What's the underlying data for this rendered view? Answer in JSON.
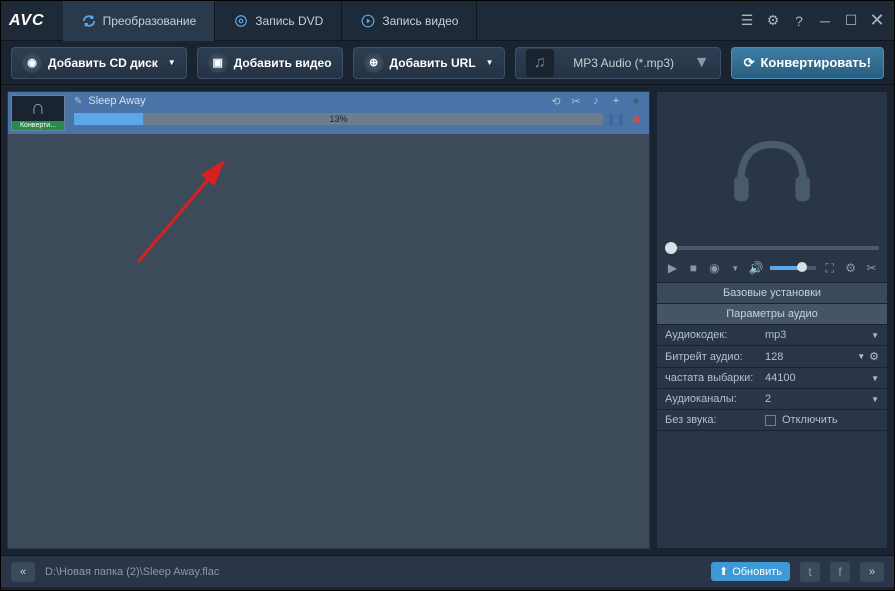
{
  "logo": "AVC",
  "tabs": [
    {
      "label": "Преобразование"
    },
    {
      "label": "Запись DVD"
    },
    {
      "label": "Запись видео"
    }
  ],
  "toolbar": {
    "addCd": "Добавить CD диск",
    "addVideo": "Добавить видео",
    "addUrl": "Добавить URL"
  },
  "format": {
    "label": "MP3 Audio (*.mp3)"
  },
  "convert": "Конвертировать!",
  "item": {
    "title": "Sleep Away",
    "status": "Конверти...",
    "progress": "13%"
  },
  "settings": {
    "header1": "Базовые установки",
    "header2": "Параметры аудио",
    "rows": [
      {
        "k": "Аудиокодек:",
        "v": "mp3"
      },
      {
        "k": "Битрейт аудио:",
        "v": "128"
      },
      {
        "k": "частата выбарки:",
        "v": "44100"
      },
      {
        "k": "Аудиоканалы:",
        "v": "2"
      },
      {
        "k": "Без звука:",
        "v": "Отключить"
      }
    ]
  },
  "status": {
    "path": "D:\\Новая папка (2)\\Sleep Away.flac",
    "update": "Обновить"
  }
}
